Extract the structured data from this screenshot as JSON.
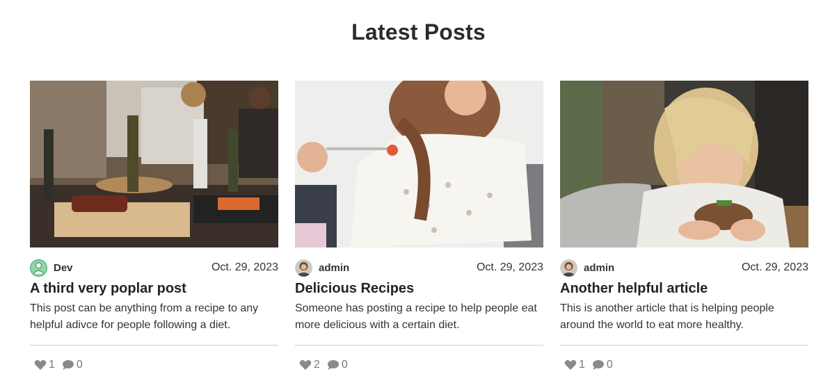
{
  "section": {
    "title": "Latest Posts"
  },
  "posts": [
    {
      "author": "Dev",
      "avatar": "avatar-dev-icon",
      "date": "Oct. 29, 2023",
      "title": "A third very poplar post",
      "excerpt": "This post can be anything from a recipe to any helpful adivce for people following a diet.",
      "likes": "1",
      "comments": "0"
    },
    {
      "author": "admin",
      "avatar": "avatar-admin-photo",
      "date": "Oct. 29, 2023",
      "title": "Delicious Recipes",
      "excerpt": "Someone has posting a recipe to help people eat more delicious with a certain diet.",
      "likes": "2",
      "comments": "0"
    },
    {
      "author": "admin",
      "avatar": "avatar-admin-photo",
      "date": "Oct. 29, 2023",
      "title": "Another helpful article",
      "excerpt": "This is another article that is helping people around the world to eat more healthy.",
      "likes": "1",
      "comments": "0"
    }
  ],
  "icons": {
    "like": "heart-icon",
    "comment": "comment-bubble-icon"
  },
  "colors": {
    "text": "#222222",
    "muted": "#777777",
    "divider": "#cfcfcf"
  }
}
